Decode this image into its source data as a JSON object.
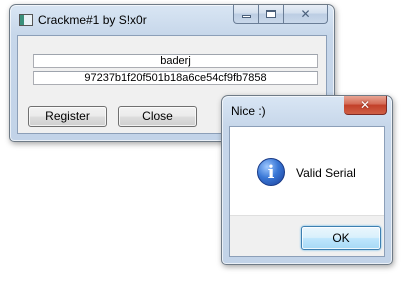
{
  "main_window": {
    "title": "Crackme#1 by S!x0r",
    "name_value": "baderj",
    "serial_value": "97237b1f20f501b18a6ce54cf9fb7858",
    "register_label": "Register",
    "close_label": "Close"
  },
  "dialog": {
    "title": "Nice :)",
    "message": "Valid Serial",
    "ok_label": "OK",
    "icon": "info-icon"
  },
  "caption_glyphs": {
    "close": "✕"
  },
  "colors": {
    "frame": "#c7d7ea",
    "client": "#f0f0f0",
    "dialog_button_area": "#f0f0f0",
    "close_hover": "#c2402a"
  }
}
